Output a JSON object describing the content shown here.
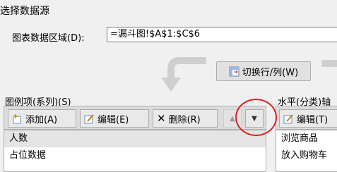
{
  "dialog": {
    "title": "选择数据源"
  },
  "data_range": {
    "label": "图表数据区域(D):",
    "value": "=漏斗图!$A$1:$C$6"
  },
  "switch_button": {
    "label": "切换行/列(W)",
    "icon": "switch-row-col-icon"
  },
  "legend": {
    "label": "图例项(系列)(S)",
    "buttons": [
      {
        "label": "添加(A)",
        "icon": "add-series-icon"
      },
      {
        "label": "编辑(E)",
        "icon": "edit-icon"
      },
      {
        "label": "删除(R)",
        "icon": "delete-icon"
      }
    ],
    "items": [
      "人数",
      "占位数据"
    ],
    "selected_index": 0
  },
  "axis": {
    "label": "水平(分类)轴",
    "edit_label": "编辑(T)",
    "items": [
      "浏览商品",
      "放入购物车"
    ]
  },
  "annotation": {
    "circle_color": "#e02020"
  }
}
